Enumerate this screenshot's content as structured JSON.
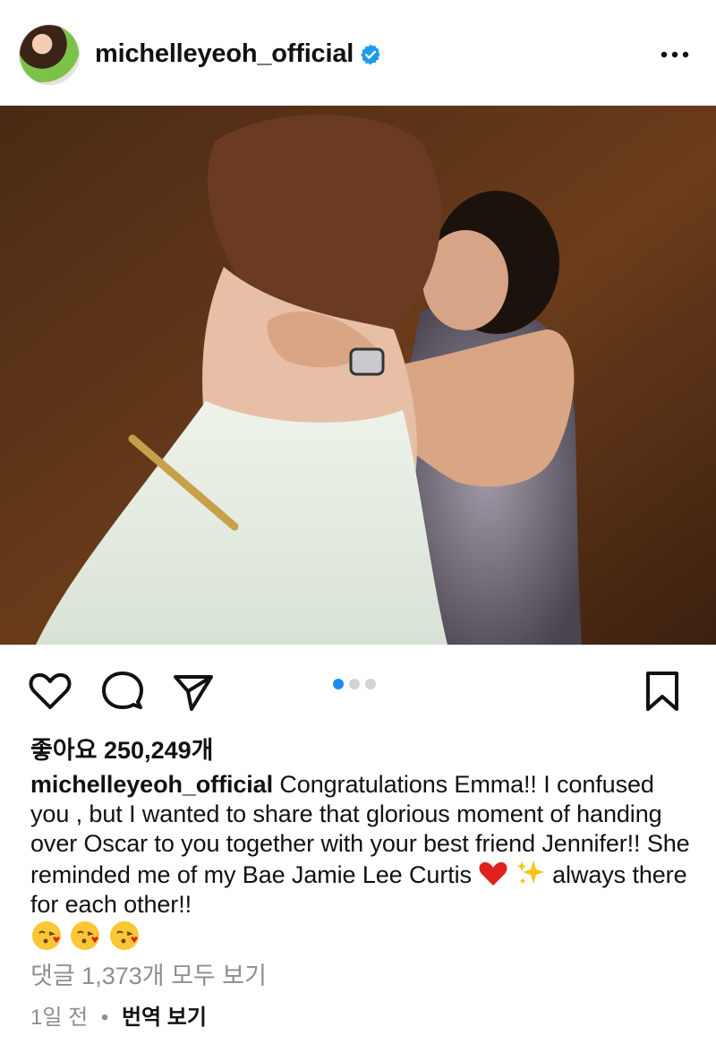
{
  "post": {
    "username": "michelleyeoh_official",
    "verified": true,
    "likes_label": "좋아요 250,249개",
    "caption_username": "michelleyeoh_official",
    "caption_line1": " Congratulations Emma!! I confused you , but I wanted to share that glorious moment of handing over Oscar to you together with your best friend Jennifer!! She reminded me of my Bae Jamie Lee Curtis ",
    "caption_line2": " always there for each other!!",
    "view_comments": "댓글 1,373개 모두 보기",
    "timestamp": "1일 전",
    "separator": "•",
    "translate": "번역 보기"
  },
  "carousel": {
    "count": 3,
    "active_index": 0
  },
  "icons": {
    "avatar": "profile-avatar",
    "verified": "verified-badge-icon",
    "more": "more-options-icon",
    "like": "heart-outline-icon",
    "comment": "comment-bubble-icon",
    "share": "paper-plane-icon",
    "save": "bookmark-outline-icon"
  },
  "colors": {
    "verified": "#1d9bf0",
    "active_dot": "#1a8cf0",
    "muted_text": "#8e8e8e"
  }
}
